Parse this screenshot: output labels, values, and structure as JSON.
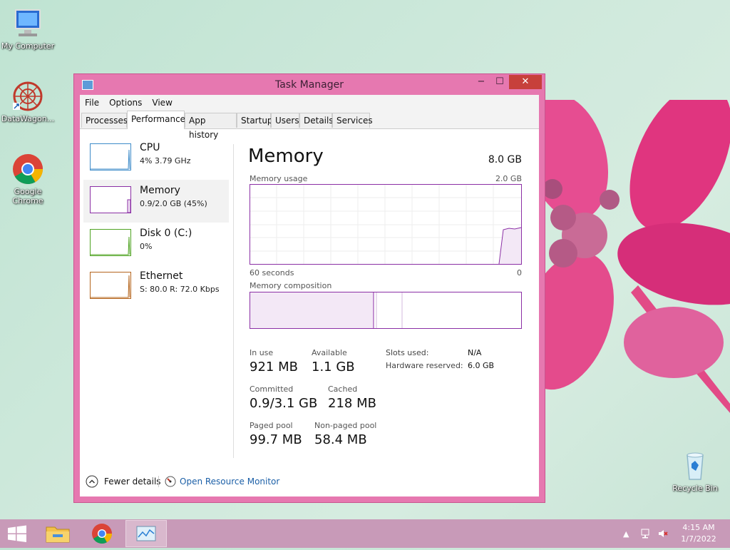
{
  "desktop": {
    "icons": [
      {
        "label": "My Computer"
      },
      {
        "label": "DataWagon..."
      },
      {
        "label": "Google Chrome"
      },
      {
        "label": "Recycle Bin"
      }
    ]
  },
  "window": {
    "title": "Task Manager",
    "controls": {
      "minimize": "−",
      "maximize": "☐",
      "close": "✕"
    },
    "menu": [
      "File",
      "Options",
      "View"
    ],
    "tabs": [
      "Processes",
      "Performance",
      "App history",
      "Startup",
      "Users",
      "Details",
      "Services"
    ],
    "active_tab": "Performance"
  },
  "sidebar": {
    "items": [
      {
        "name": "CPU",
        "value": "4%  3.79 GHz",
        "color": "#3d8bc9"
      },
      {
        "name": "Memory",
        "value": "0.9/2.0 GB (45%)",
        "color": "#8b2fa5"
      },
      {
        "name": "Disk 0 (C:)",
        "value": "0%",
        "color": "#4fa322"
      },
      {
        "name": "Ethernet",
        "value": "S: 80.0  R: 72.0 Kbps",
        "color": "#b5651d"
      }
    ]
  },
  "memory": {
    "heading": "Memory",
    "total": "8.0 GB",
    "usage_label": "Memory usage",
    "usage_max": "2.0 GB",
    "time_left": "60 seconds",
    "time_right": "0",
    "composition_label": "Memory composition",
    "stats": {
      "in_use_label": "In use",
      "in_use": "921 MB",
      "available_label": "Available",
      "available": "1.1 GB",
      "committed_label": "Committed",
      "committed": "0.9/3.1 GB",
      "cached_label": "Cached",
      "cached": "218 MB",
      "paged_label": "Paged pool",
      "paged": "99.7 MB",
      "nonpaged_label": "Non-paged pool",
      "nonpaged": "58.4 MB",
      "slots_label": "Slots used:",
      "slots": "N/A",
      "hwres_label": "Hardware reserved:",
      "hwres": "6.0 GB"
    }
  },
  "footer": {
    "fewer_details": "Fewer details",
    "open_resource_monitor": "Open Resource Monitor"
  },
  "taskbar": {
    "time": "4:15 AM",
    "date": "1/7/2022"
  },
  "colors": {
    "accent": "#e678b0",
    "memory_graph": "#8b2fa5",
    "link": "#1b5fa7"
  }
}
